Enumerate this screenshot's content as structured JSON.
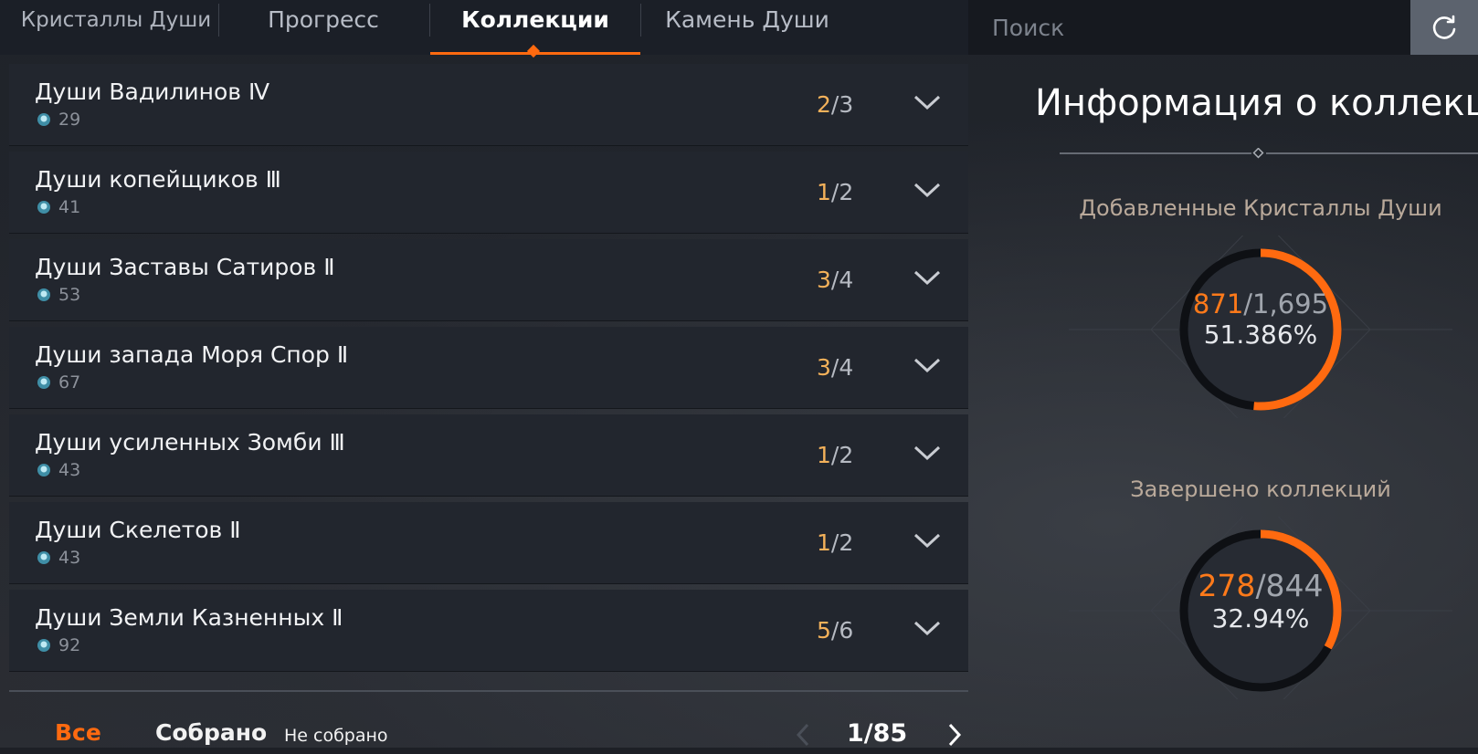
{
  "tabs": [
    {
      "label": "Кристаллы Души",
      "active": false
    },
    {
      "label": "Прогресс",
      "active": false
    },
    {
      "label": "Коллекции",
      "active": true
    },
    {
      "label": "Камень Души",
      "active": false
    }
  ],
  "search": {
    "placeholder": "Поиск"
  },
  "collections": [
    {
      "name": "Души Вадилинов Ⅳ",
      "points": "29",
      "collected": "2",
      "total": "3"
    },
    {
      "name": "Души копейщиков Ⅲ",
      "points": "41",
      "collected": "1",
      "total": "2"
    },
    {
      "name": "Души Заставы Сатиров Ⅱ",
      "points": "53",
      "collected": "3",
      "total": "4"
    },
    {
      "name": "Души запада Моря Спор Ⅱ",
      "points": "67",
      "collected": "3",
      "total": "4"
    },
    {
      "name": "Души усиленных Зомби Ⅲ",
      "points": "43",
      "collected": "1",
      "total": "2"
    },
    {
      "name": "Души Скелетов Ⅱ",
      "points": "43",
      "collected": "1",
      "total": "2"
    },
    {
      "name": "Души Земли Казненных Ⅱ",
      "points": "92",
      "collected": "5",
      "total": "6"
    }
  ],
  "filters": {
    "all": "Все",
    "collected": "Собрано",
    "not_collected": "Не собрано"
  },
  "pagination": {
    "label": "1/85"
  },
  "info": {
    "title": "Информация о коллекции",
    "crystals": {
      "title": "Добавленные Кристаллы Души",
      "current": "871",
      "total": "/1,695",
      "percent": "51.386%",
      "fraction": 0.51386
    },
    "completed": {
      "title": "Завершено коллекций",
      "current": "278",
      "total": "/844",
      "percent": "32.94%",
      "fraction": 0.3294
    }
  },
  "colors": {
    "accent": "#ff6a10",
    "gold": "#f3b15a",
    "ring_track": "#0e1014"
  }
}
